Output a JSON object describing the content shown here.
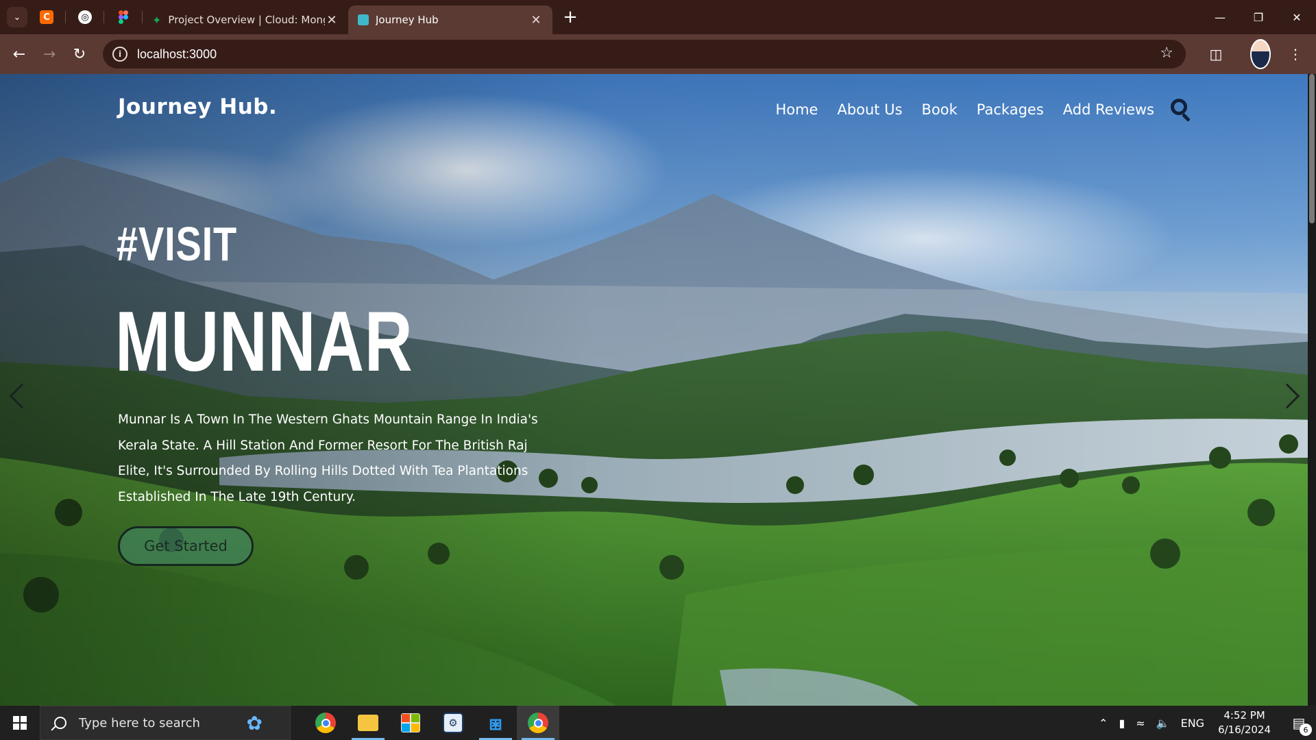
{
  "browser": {
    "pinned_tabs": [
      {
        "icon": "canva-icon",
        "color": "#ff6a00",
        "glyph": "C"
      },
      {
        "icon": "chatgpt-icon",
        "color": "#ffffff",
        "glyph": "◎"
      },
      {
        "icon": "figma-icon",
        "color": "#f24e1e",
        "glyph": "✿"
      }
    ],
    "tabs": [
      {
        "title": "Project Overview | Cloud: Mong",
        "icon": "mongodb-leaf-icon",
        "active": false
      },
      {
        "title": "Journey Hub",
        "icon": "site-icon",
        "active": true
      }
    ],
    "url": "localhost:3000"
  },
  "site": {
    "brand": "Journey Hub.",
    "nav": [
      "Home",
      "About Us",
      "Book",
      "Packages",
      "Add Reviews"
    ],
    "hero": {
      "kicker": "#VISIT",
      "title": "MUNNAR",
      "description": "Munnar Is A Town In The Western Ghats Mountain Range In India's Kerala State. A Hill Station And Former Resort For The British Raj Elite, It's Surrounded By Rolling Hills Dotted With Tea Plantations Established In The Late 19th Century.",
      "cta": "Get Started"
    }
  },
  "taskbar": {
    "search_placeholder": "Type here to search",
    "apps": [
      "chrome-icon",
      "file-explorer-icon",
      "microsoft-store-icon",
      "terminal-icon",
      "vscode-icon",
      "chrome-profile-icon"
    ],
    "language": "ENG",
    "time": "4:52 PM",
    "date": "6/16/2024",
    "notification_count": "6"
  },
  "colors": {
    "tabbar": "#361c17",
    "toolbar": "#5b3a33",
    "accent_taskbar": "#76b9ed"
  }
}
